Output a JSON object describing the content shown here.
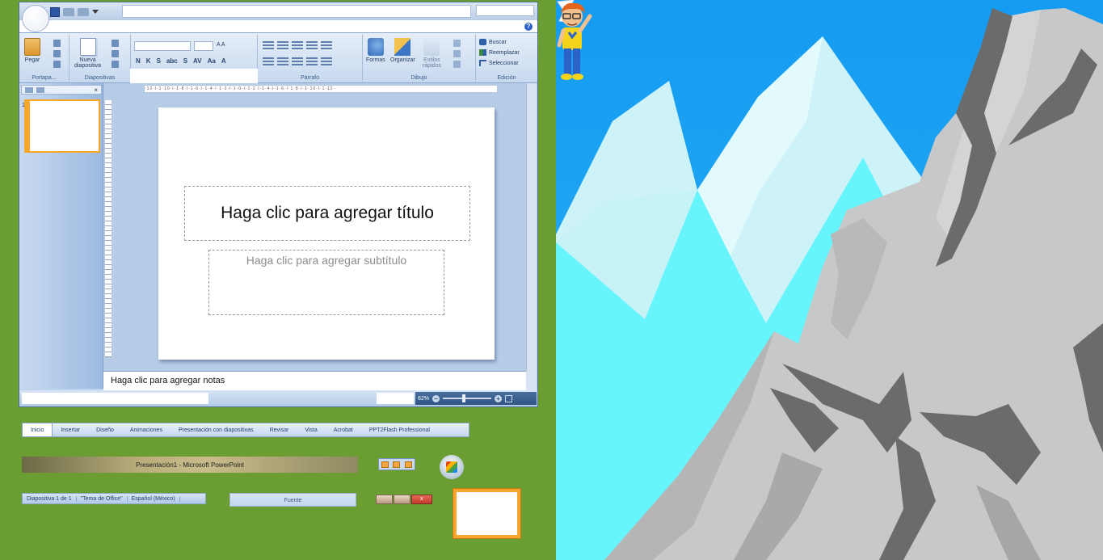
{
  "ribbon": {
    "groups": [
      {
        "label": "Portapa..."
      },
      {
        "label": "Diapositivas"
      },
      {
        "label": "Párrafo"
      },
      {
        "label": "Dibujo"
      },
      {
        "label": "Edición"
      }
    ],
    "paste_label": "Pegar",
    "new_slide_label_1": "Nueva",
    "new_slide_label_2": "diapositiva",
    "shapes_label": "Formas",
    "arrange_label": "Organizar",
    "quick_styles_label_1": "Estilos",
    "quick_styles_label_2": "rápidos",
    "find_label": "Buscar",
    "replace_label": "Reemplazar",
    "select_label": "Seleccionar",
    "format_buttons": [
      "N",
      "K",
      "S",
      "abc",
      "S",
      "AV",
      "Aa",
      "A"
    ]
  },
  "ruler": {
    "horizontal": "·12·l·1·10·l·1·8·l·1·6·l·1·4·l·1·2·l·1·0·l·1·2·l·1·4·l·1·6·l·1·8·l·1·10·l·1·12·"
  },
  "slide_pane": {
    "slide_number": "1"
  },
  "slide": {
    "title_placeholder": "Haga clic para agregar título",
    "subtitle_placeholder": "Haga clic para agregar subtítulo"
  },
  "notes": {
    "placeholder": "Haga clic para agregar notas"
  },
  "status": {
    "zoom": "62%",
    "slide_info": "Diapositiva 1 de 1",
    "theme": "\"Tema de Office\"",
    "language": "Español (México)"
  },
  "ribbon_tabs": [
    "Inicio",
    "Insertar",
    "Diseño",
    "Animaciones",
    "Presentación con diapositivas",
    "Revisar",
    "Vista",
    "Acrobat",
    "PPT2Flash Professional"
  ],
  "window_title": "Presentación1 - Microsoft PowerPoint",
  "font_group_label": "Fuente",
  "colors": {
    "green_background": "#6a9e33",
    "sky": "#1aa0f5",
    "rock": "#c9c9c9",
    "accent_orange": "#f7a730"
  }
}
